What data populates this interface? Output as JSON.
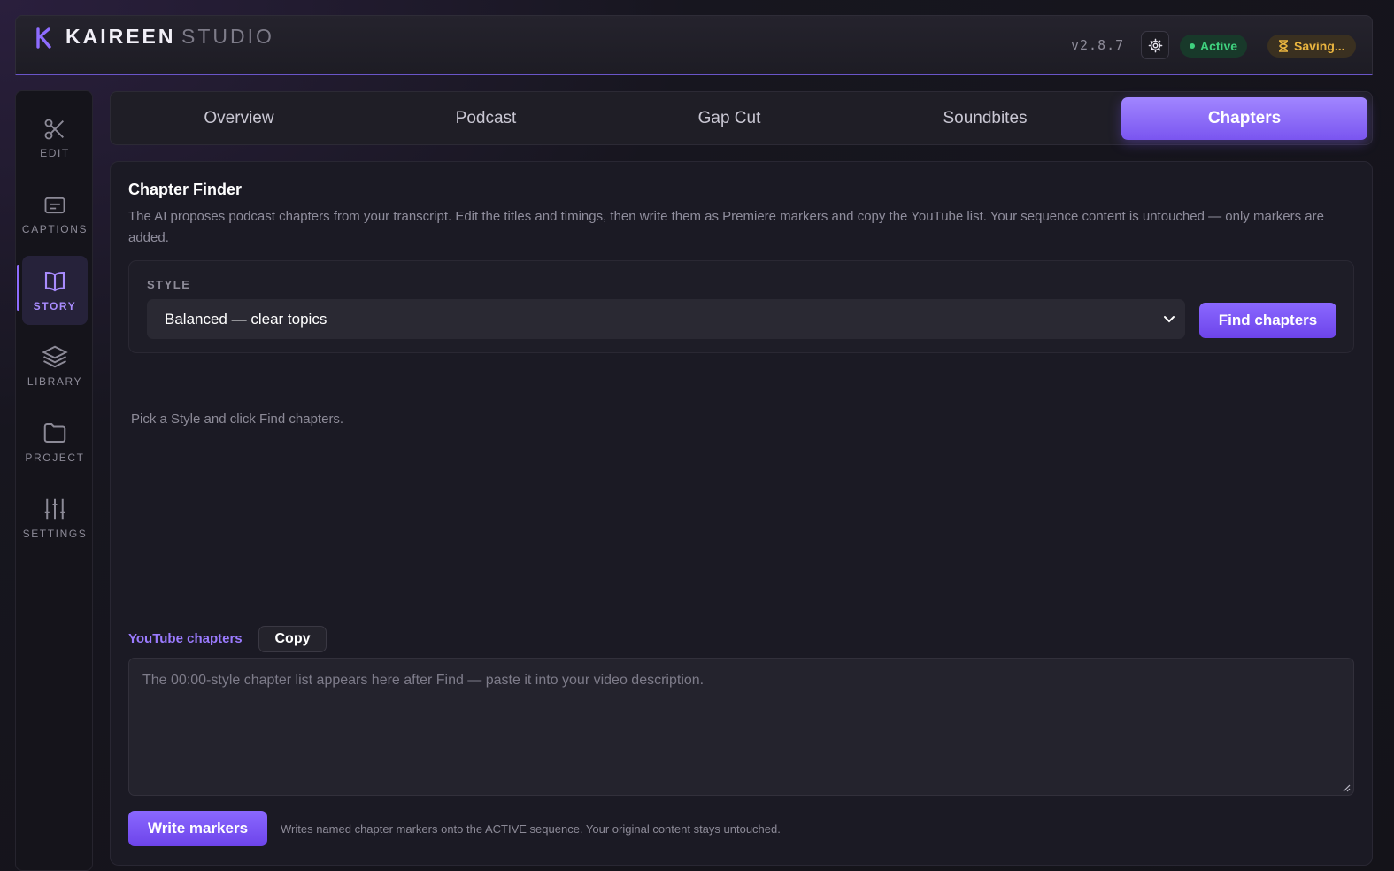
{
  "header": {
    "brand": "KAIREEN",
    "brand_sub": "STUDIO",
    "version": "v2.8.7",
    "status_active": "Active",
    "status_saving": "Saving..."
  },
  "sidebar": {
    "items": [
      {
        "label": "EDIT",
        "icon": "scissors-icon"
      },
      {
        "label": "CAPTIONS",
        "icon": "captions-icon"
      },
      {
        "label": "STORY",
        "icon": "book-icon"
      },
      {
        "label": "LIBRARY",
        "icon": "layers-icon"
      },
      {
        "label": "PROJECT",
        "icon": "folder-icon"
      },
      {
        "label": "SETTINGS",
        "icon": "sliders-icon"
      }
    ],
    "active": "STORY"
  },
  "tabs": [
    {
      "label": "Overview"
    },
    {
      "label": "Podcast"
    },
    {
      "label": "Gap Cut"
    },
    {
      "label": "Soundbites"
    },
    {
      "label": "Chapters"
    }
  ],
  "active_tab": "Chapters",
  "panel": {
    "title": "Chapter Finder",
    "description": "The AI proposes podcast chapters from your transcript. Edit the titles and timings, then write them as Premiere markers and copy the YouTube list. Your sequence content is untouched — only markers are added.",
    "style_label": "STYLE",
    "style_value": "Balanced — clear topics",
    "find_button": "Find chapters",
    "empty_hint": "Pick a Style and click Find chapters.",
    "youtube_label": "YouTube chapters",
    "copy_button": "Copy",
    "youtube_placeholder": "The 00:00-style chapter list appears here after Find — paste it into your video description.",
    "write_button": "Write markers",
    "write_note": "Writes named chapter markers onto the ACTIVE sequence. Your original content stays untouched."
  },
  "colors": {
    "accent": "#8a68ff",
    "active_green": "#3fd17e",
    "saving_amber": "#e9b43f"
  }
}
